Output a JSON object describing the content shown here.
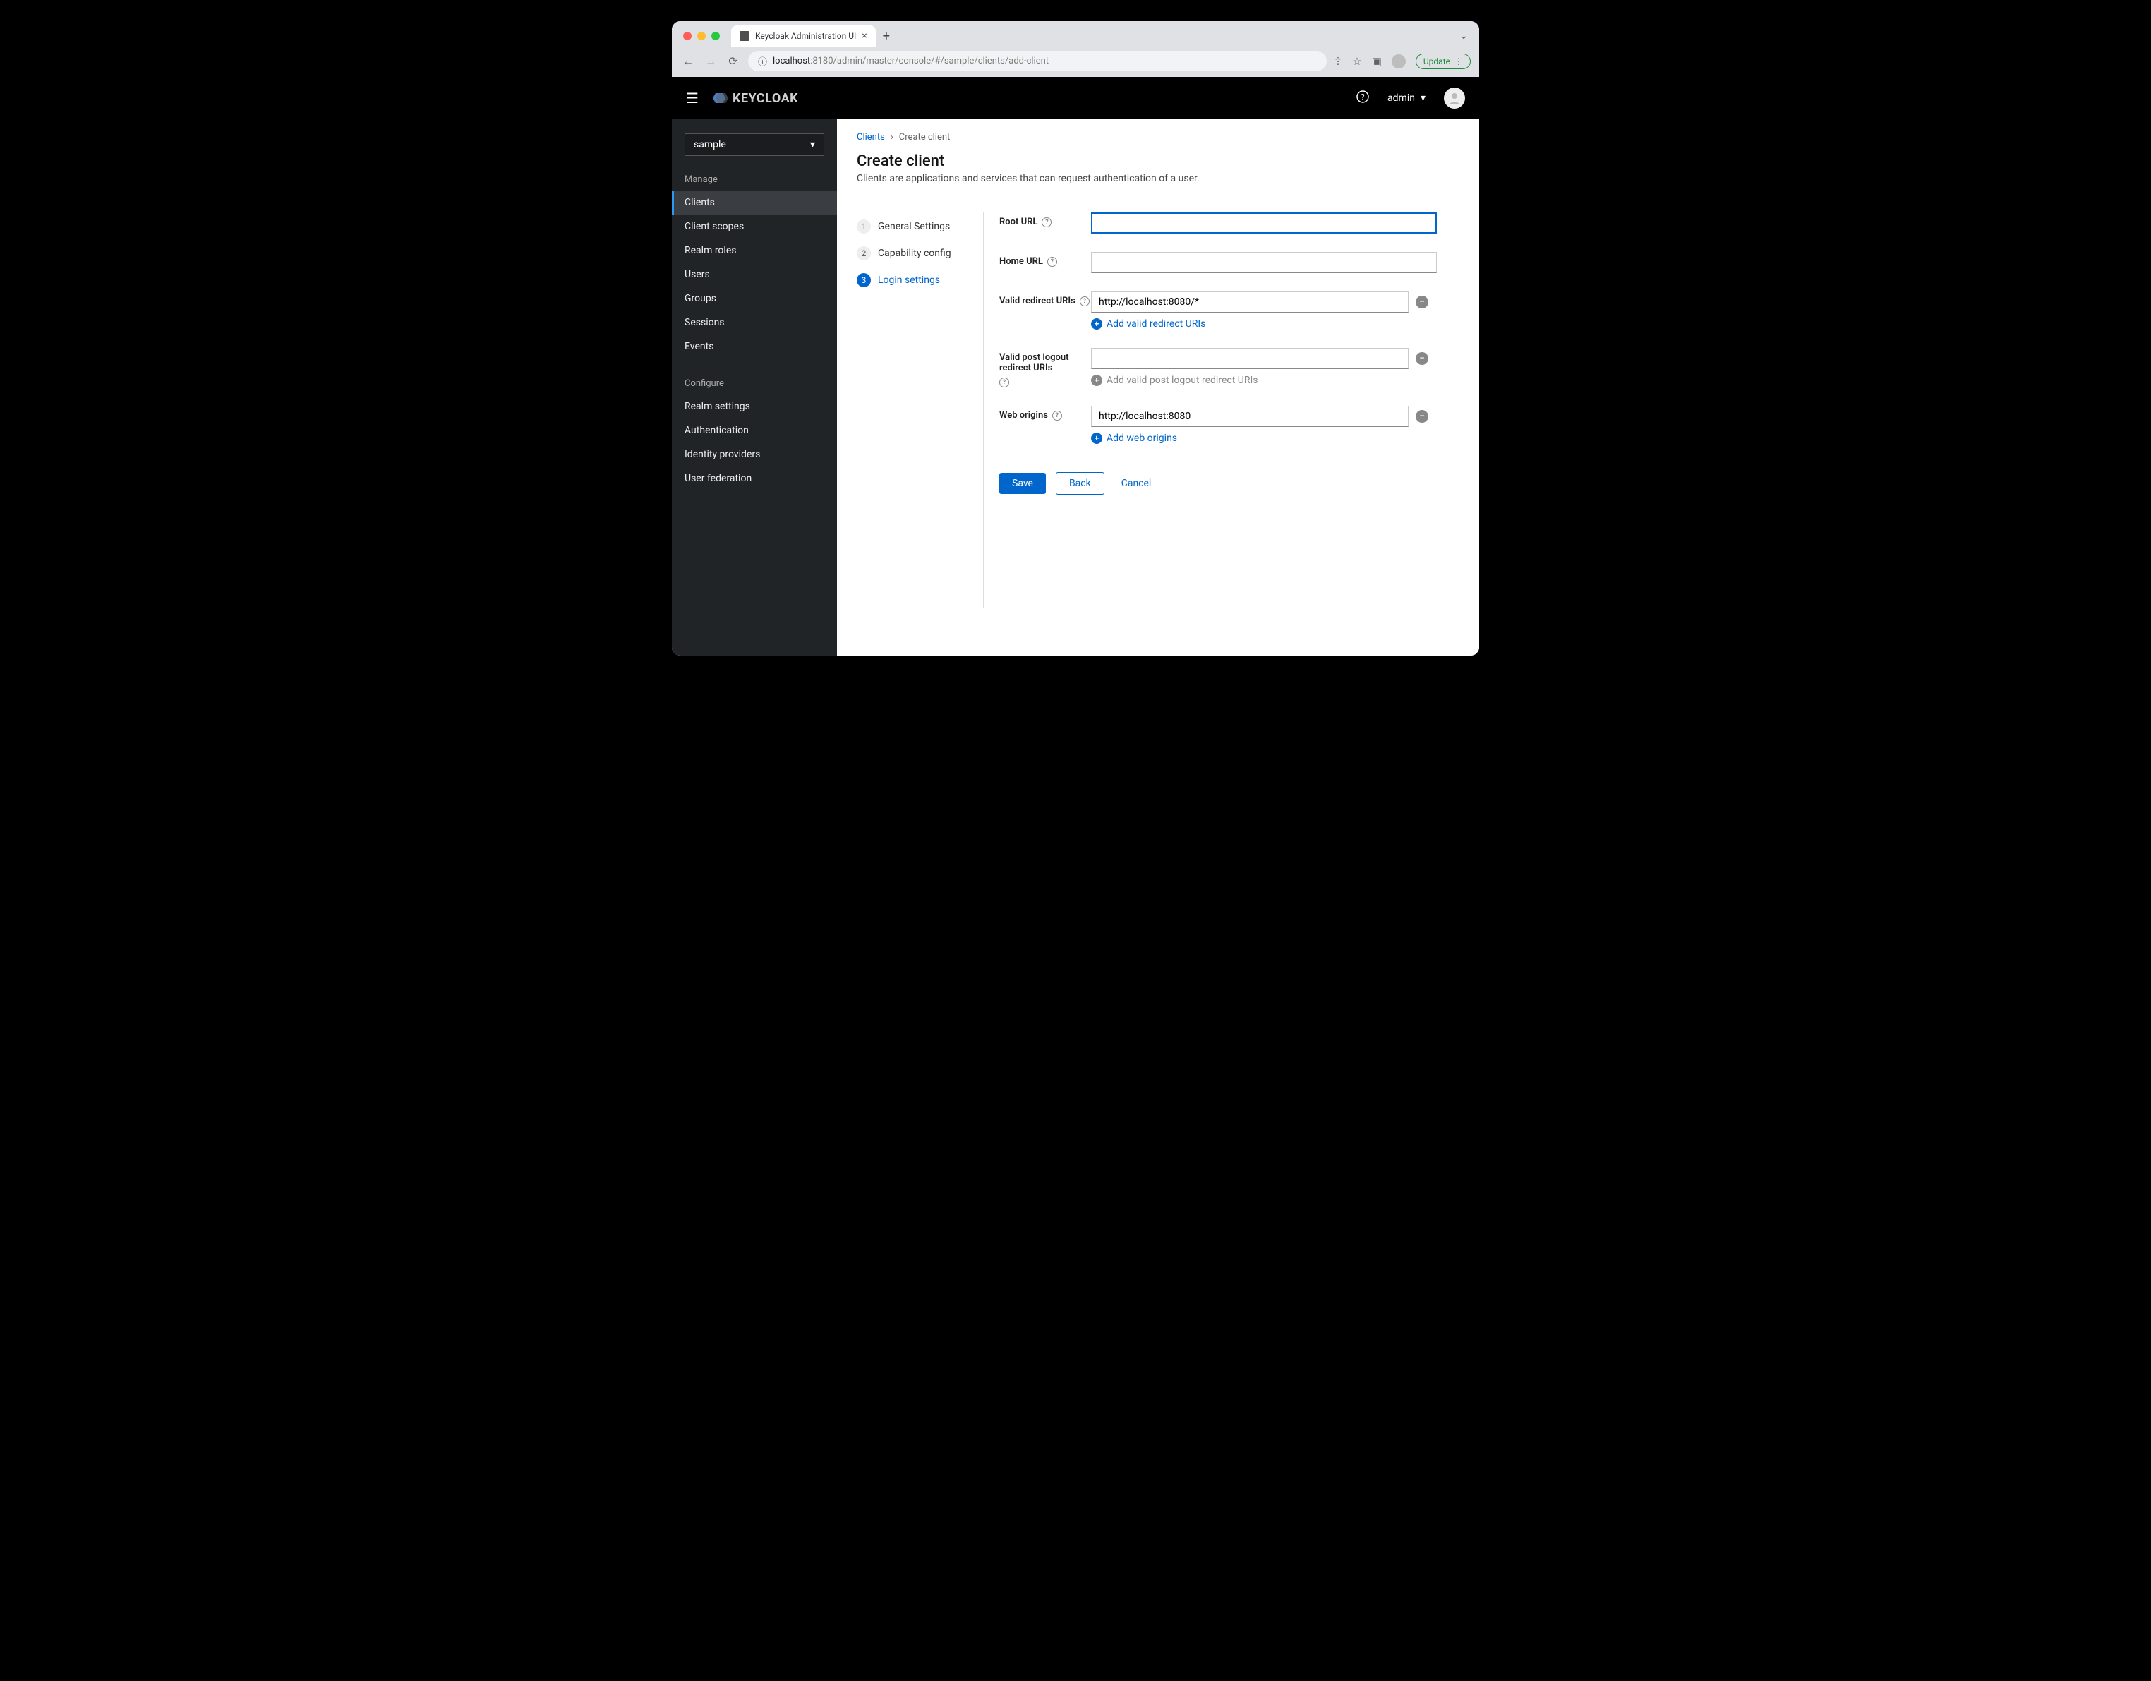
{
  "browser": {
    "tab_title": "Keycloak Administration UI",
    "url_host": "localhost",
    "url_port_path": ":8180/admin/master/console/#/sample/clients/add-client",
    "update_label": "Update"
  },
  "header": {
    "brand": "KEYCLOAK",
    "user": "admin"
  },
  "sidebar": {
    "realm": "sample",
    "section_manage": "Manage",
    "items_manage": [
      "Clients",
      "Client scopes",
      "Realm roles",
      "Users",
      "Groups",
      "Sessions",
      "Events"
    ],
    "section_configure": "Configure",
    "items_configure": [
      "Realm settings",
      "Authentication",
      "Identity providers",
      "User federation"
    ]
  },
  "breadcrumb": {
    "link": "Clients",
    "current": "Create client"
  },
  "page": {
    "title": "Create client",
    "subtitle": "Clients are applications and services that can request authentication of a user."
  },
  "steps": [
    {
      "num": "1",
      "label": "General Settings"
    },
    {
      "num": "2",
      "label": "Capability config"
    },
    {
      "num": "3",
      "label": "Login settings"
    }
  ],
  "form": {
    "root_url_label": "Root URL",
    "root_url_value": "",
    "home_url_label": "Home URL",
    "home_url_value": "",
    "valid_redirect_label": "Valid redirect URIs",
    "valid_redirect_value": "http://localhost:8080/*",
    "valid_redirect_add": "Add valid redirect URIs",
    "valid_post_logout_label": "Valid post logout redirect URIs",
    "valid_post_logout_value": "",
    "valid_post_logout_add": "Add valid post logout redirect URIs",
    "web_origins_label": "Web origins",
    "web_origins_value": "http://localhost:8080",
    "web_origins_add": "Add web origins"
  },
  "actions": {
    "save": "Save",
    "back": "Back",
    "cancel": "Cancel"
  }
}
